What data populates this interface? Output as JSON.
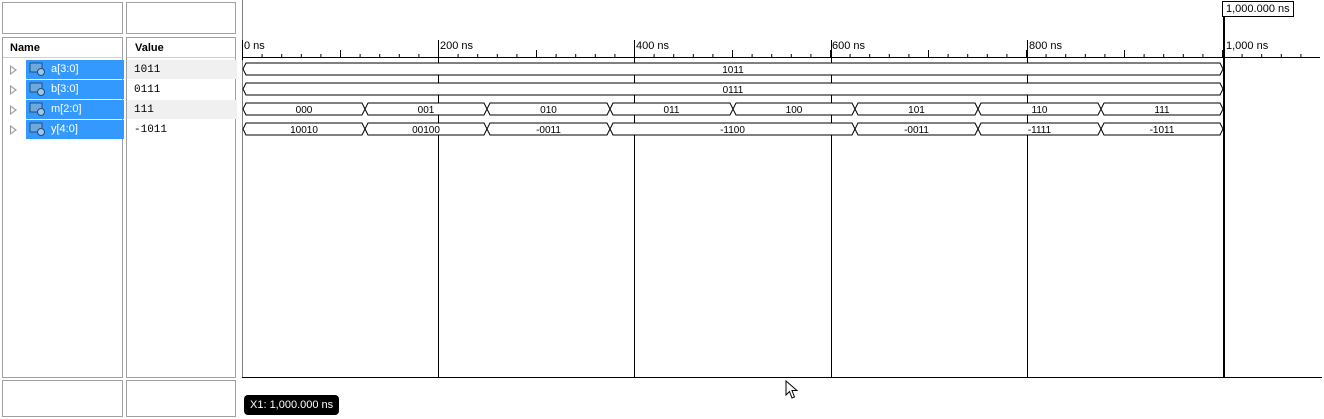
{
  "columns": {
    "name": "Name",
    "value": "Value"
  },
  "signals": [
    {
      "name": "a[3:0]",
      "value": "1011"
    },
    {
      "name": "b[3:0]",
      "value": "0111"
    },
    {
      "name": "m[2:0]",
      "value": "111"
    },
    {
      "name": "y[4:0]",
      "value": "-1011"
    }
  ],
  "ruler": {
    "labels": [
      "0 ns",
      "200 ns",
      "400 ns",
      "600 ns",
      "800 ns",
      "1,000 ns"
    ]
  },
  "waves": {
    "a": [
      "1011"
    ],
    "b": [
      "0111"
    ],
    "m": [
      "000",
      "001",
      "010",
      "011",
      "100",
      "101",
      "110",
      "111"
    ],
    "y": [
      "10010",
      "00100",
      "-0011",
      "-1100",
      "-0011",
      "-1111",
      "-1011"
    ]
  },
  "cursor": {
    "label": "X1: 1,000.000 ns",
    "marker": "1,000.000 ns"
  }
}
